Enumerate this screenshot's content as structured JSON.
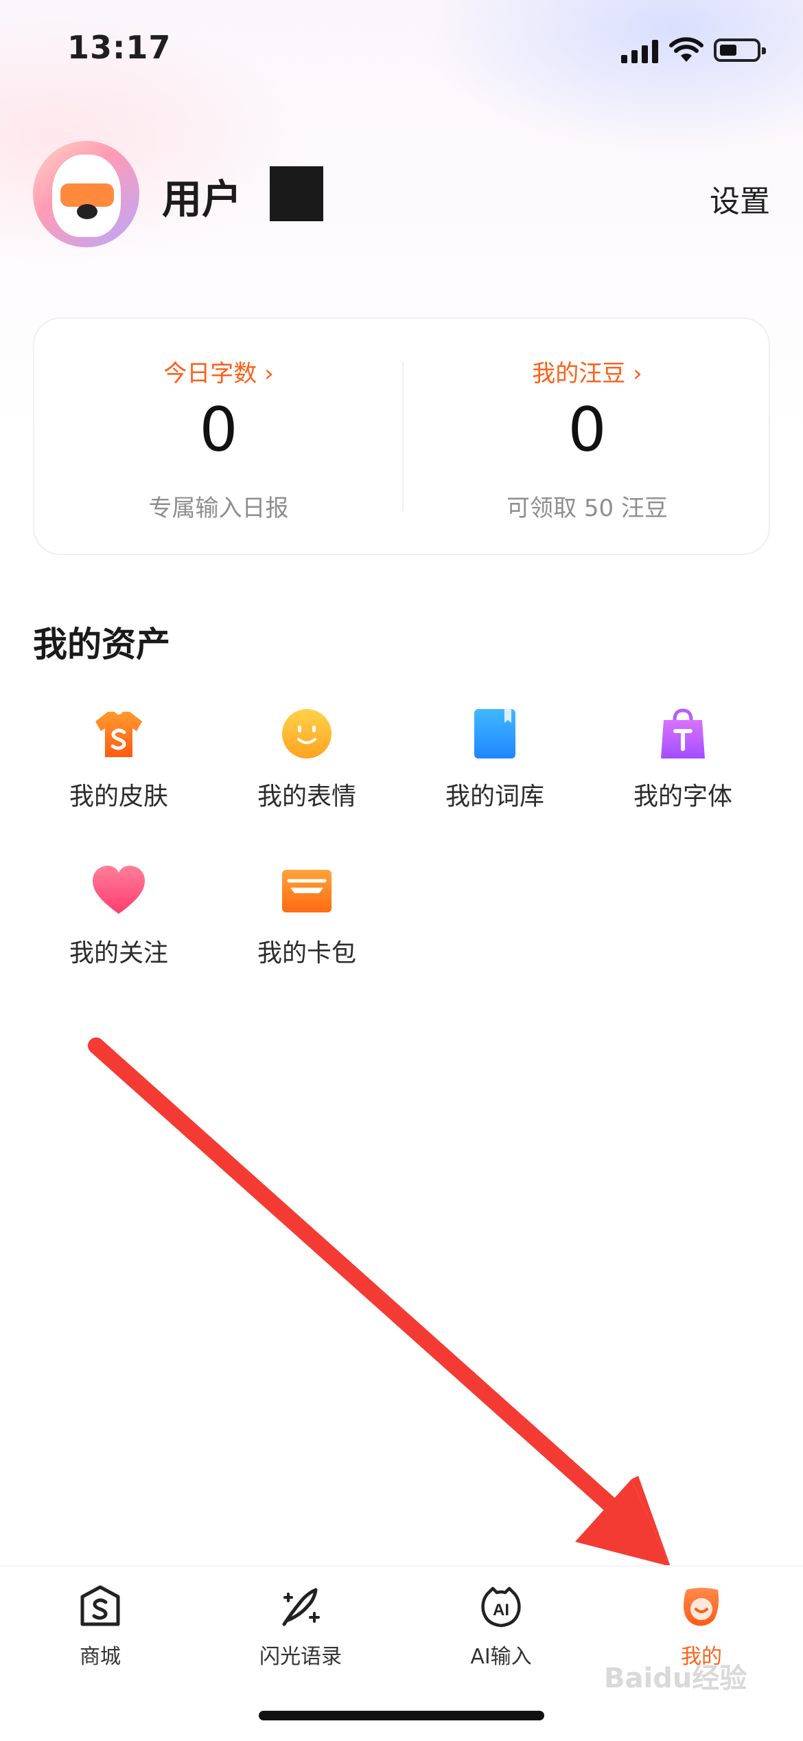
{
  "status_bar": {
    "time": "13:17"
  },
  "profile": {
    "username": "用户",
    "settings_label": "设置"
  },
  "stats": {
    "left": {
      "link": "今日字数 ›",
      "value": "0",
      "sub": "专属输入日报"
    },
    "right": {
      "link": "我的汪豆 ›",
      "value": "0",
      "sub": "可领取 50 汪豆"
    }
  },
  "assets": {
    "title": "我的资产",
    "items": [
      {
        "label": "我的皮肤",
        "icon": "tshirt-skin-icon"
      },
      {
        "label": "我的表情",
        "icon": "smiley-emoji-icon"
      },
      {
        "label": "我的词库",
        "icon": "book-lexicon-icon"
      },
      {
        "label": "我的字体",
        "icon": "shopping-bag-font-icon"
      },
      {
        "label": "我的关注",
        "icon": "heart-icon"
      },
      {
        "label": "我的卡包",
        "icon": "card-wallet-icon"
      }
    ]
  },
  "tabs": [
    {
      "label": "商城",
      "icon": "store-icon"
    },
    {
      "label": "闪光语录",
      "icon": "quill-sparkle-icon"
    },
    {
      "label": "AI输入",
      "icon": "ai-input-icon"
    },
    {
      "label": "我的",
      "icon": "profile-face-icon"
    }
  ],
  "watermark": "Baidu经验",
  "colors": {
    "accent": "#ff5f17",
    "arrow": "#f43b33"
  }
}
